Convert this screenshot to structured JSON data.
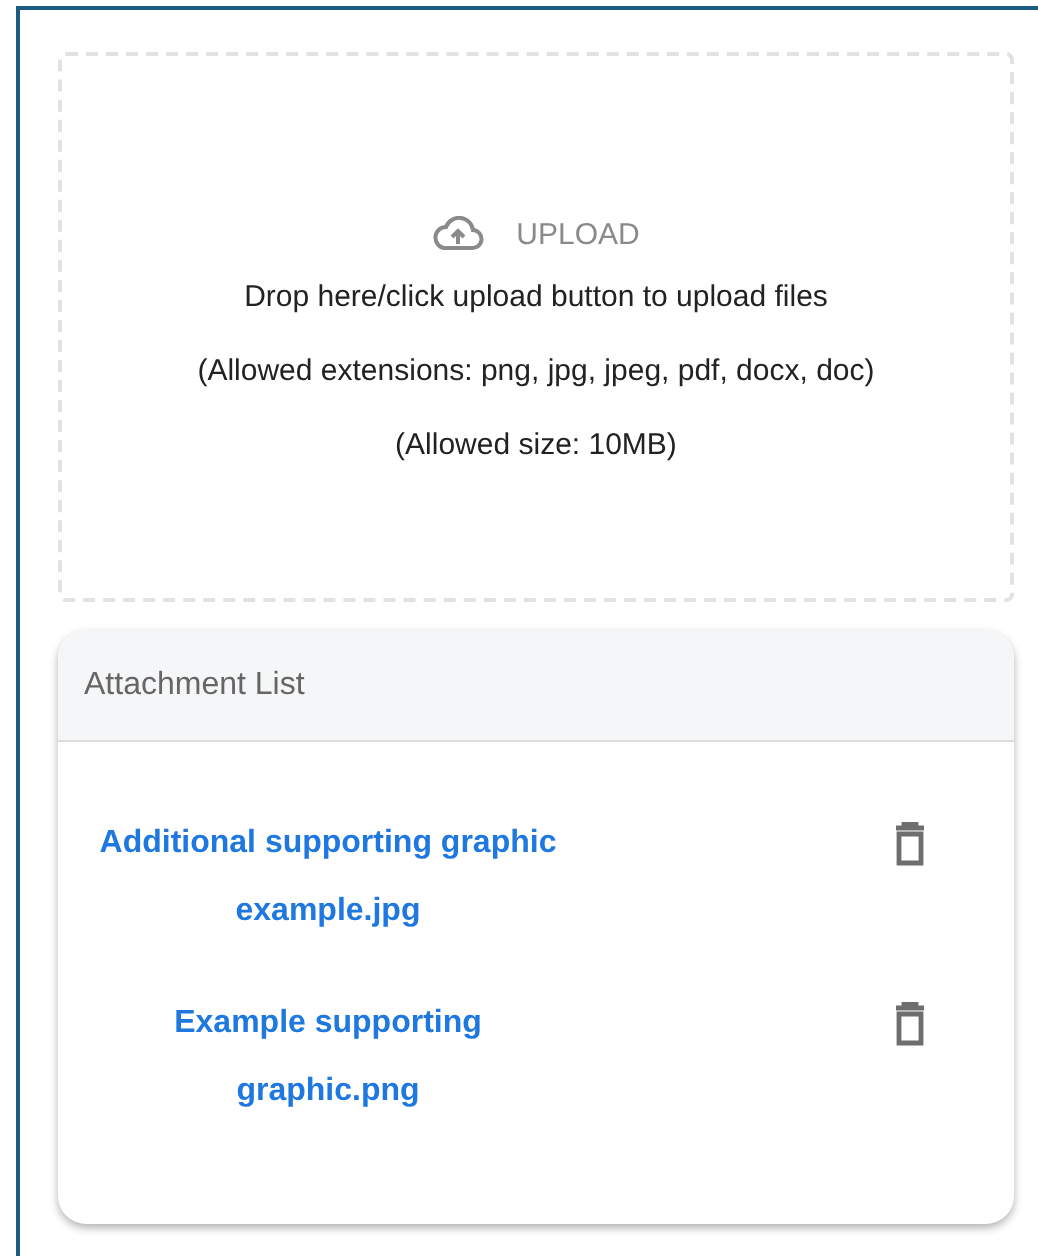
{
  "dropzone": {
    "button": "UPLOAD",
    "instruction": "Drop here/click upload button to upload files",
    "extensions": "(Allowed extensions: png, jpg, jpeg, pdf, docx, doc)",
    "size": "(Allowed size: 10MB)"
  },
  "attachments": {
    "title": "Attachment List",
    "files": [
      {
        "name": "Additional supporting graphic example.jpg"
      },
      {
        "name": "Example supporting graphic.png"
      }
    ]
  }
}
